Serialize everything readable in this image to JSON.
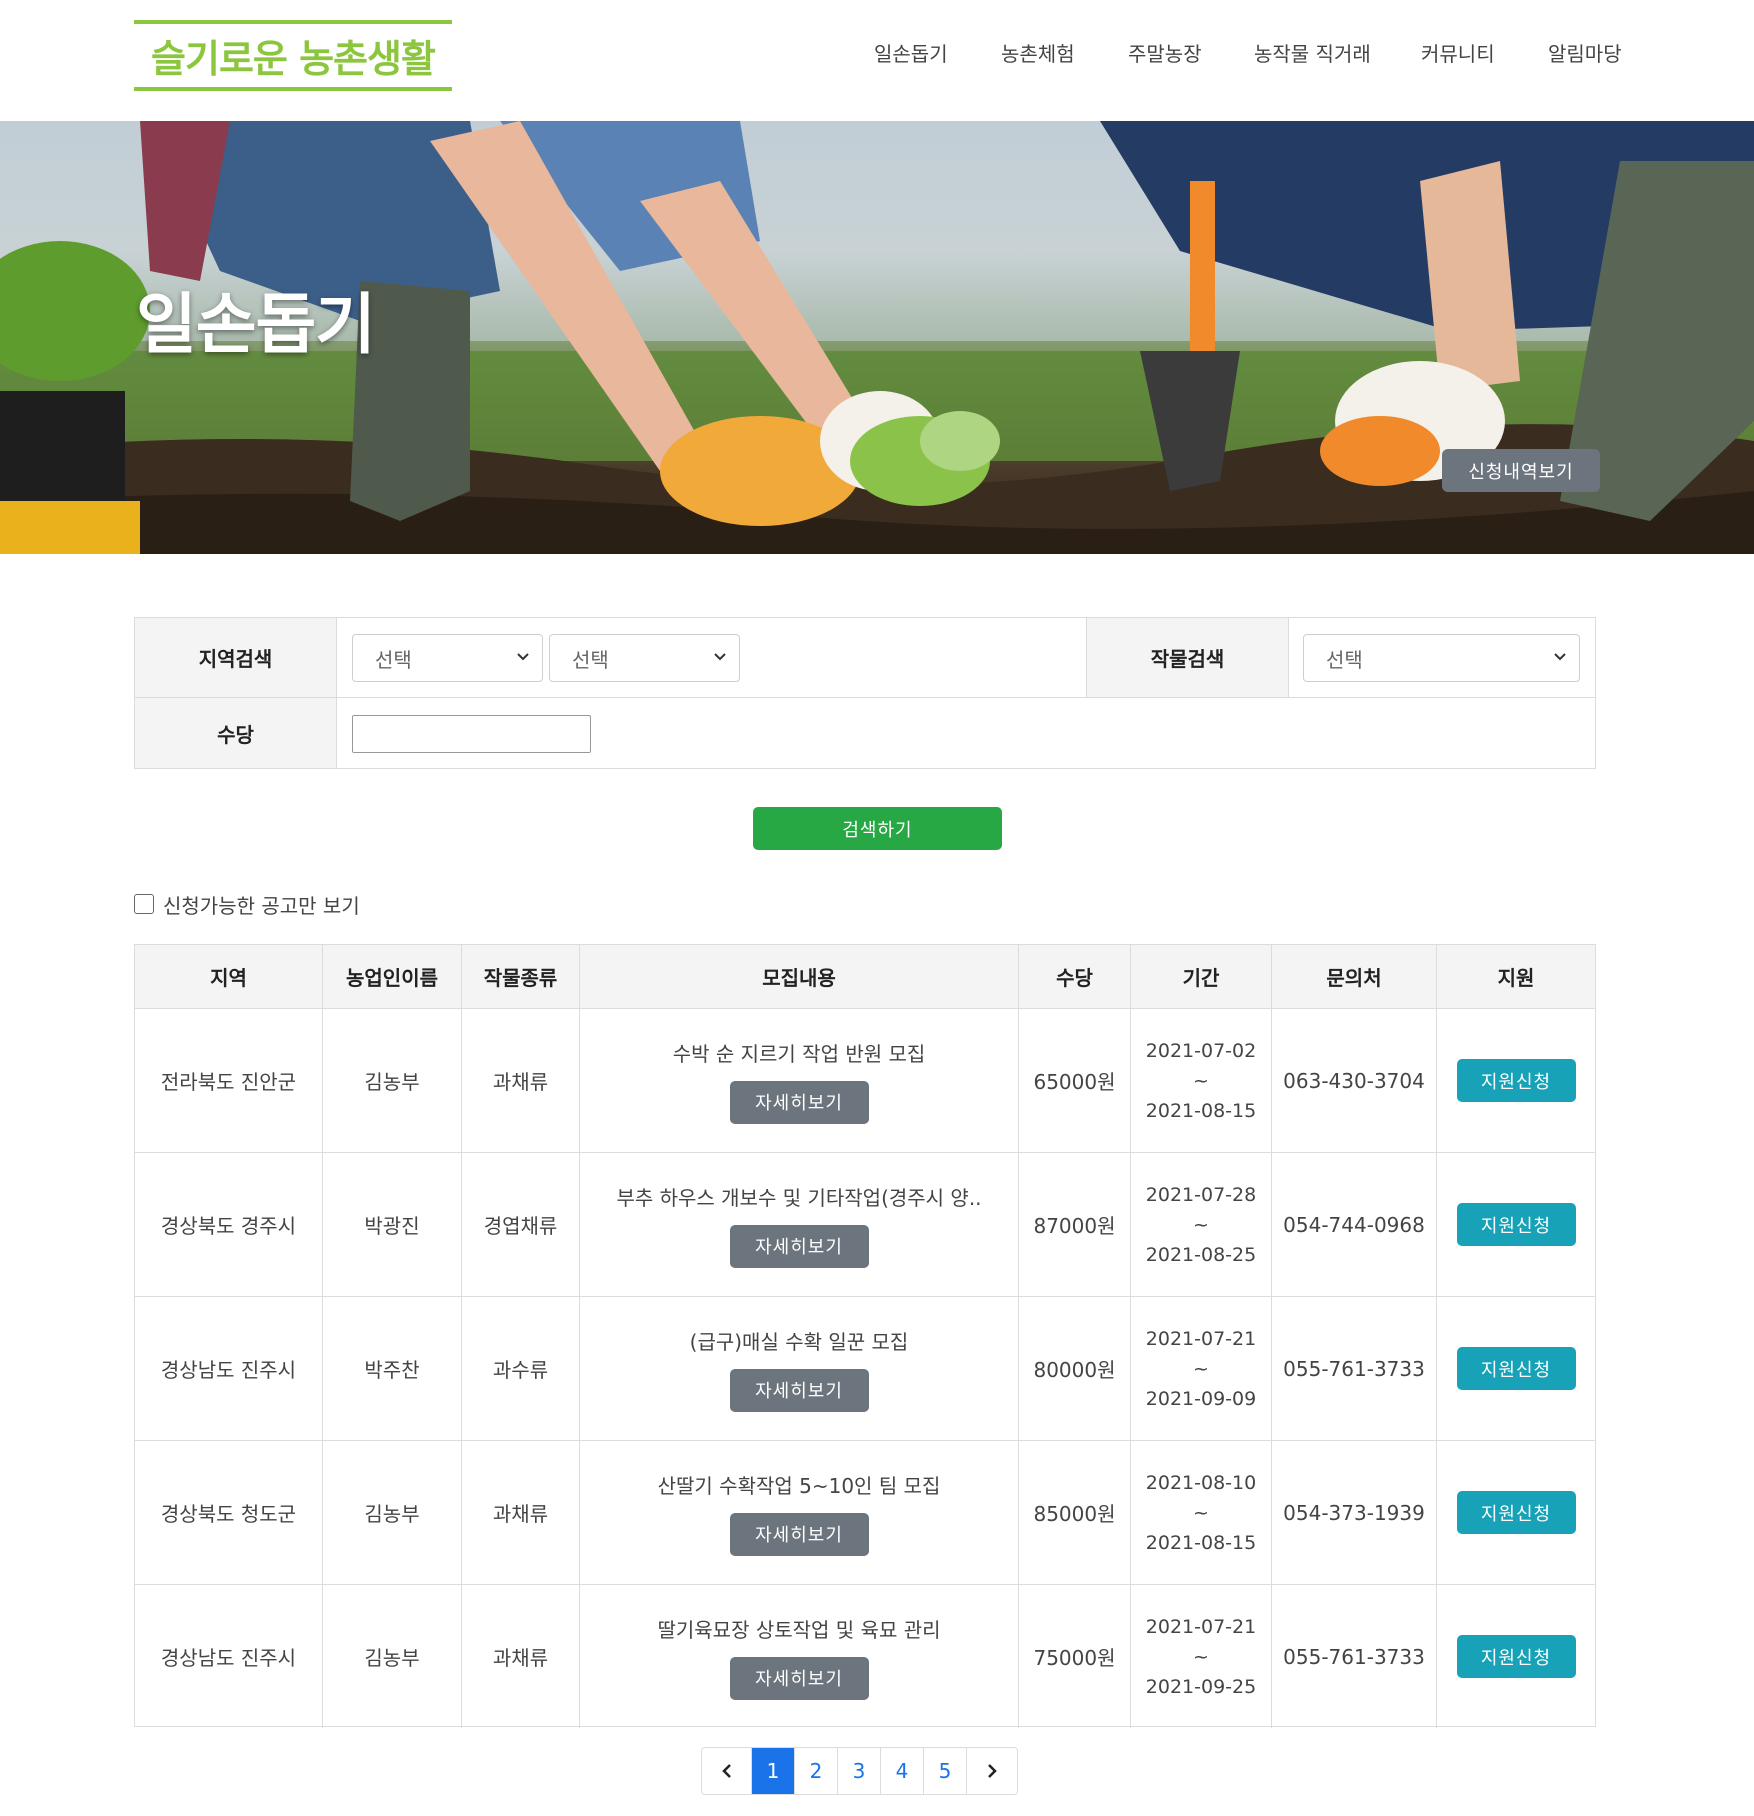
{
  "header": {
    "logo": "슬기로운 농촌생활",
    "nav": [
      "일손돕기",
      "농촌체험",
      "주말농장",
      "농작물 직거래",
      "커뮤니티",
      "알림마당"
    ]
  },
  "hero": {
    "title": "일손돕기",
    "history_button": "신청내역보기"
  },
  "search": {
    "region_label": "지역검색",
    "region_select_1": "선택",
    "region_select_2": "선택",
    "crop_label": "작물검색",
    "crop_select": "선택",
    "wage_label": "수당",
    "wage_value": "",
    "submit": "검색하기",
    "available_only_label": "신청가능한 공고만 보기",
    "available_only_checked": false
  },
  "table": {
    "headers": [
      "지역",
      "농업인이름",
      "작물종류",
      "모집내용",
      "수당",
      "기간",
      "문의처",
      "지원"
    ],
    "detail_label": "자세히보기",
    "apply_label": "지원신청",
    "rows": [
      {
        "region": "전라북도 진안군",
        "farmer": "김농부",
        "crop": "과채류",
        "title": "수박 순 지르기 작업 반원 모집",
        "wage": "65000원",
        "start": "2021-07-02",
        "sep": "~",
        "end": "2021-08-15",
        "contact": "063-430-3704"
      },
      {
        "region": "경상북도 경주시",
        "farmer": "박광진",
        "crop": "경엽채류",
        "title": "부추 하우스 개보수 및 기타작업(경주시 양..",
        "wage": "87000원",
        "start": "2021-07-28",
        "sep": "~",
        "end": "2021-08-25",
        "contact": "054-744-0968"
      },
      {
        "region": "경상남도 진주시",
        "farmer": "박주찬",
        "crop": "과수류",
        "title": "(급구)매실 수확 일꾼 모집",
        "wage": "80000원",
        "start": "2021-07-21",
        "sep": "~",
        "end": "2021-09-09",
        "contact": "055-761-3733"
      },
      {
        "region": "경상북도 청도군",
        "farmer": "김농부",
        "crop": "과채류",
        "title": "산딸기 수확작업 5~10인 팀 모집",
        "wage": "85000원",
        "start": "2021-08-10",
        "sep": "~",
        "end": "2021-08-15",
        "contact": "054-373-1939"
      },
      {
        "region": "경상남도 진주시",
        "farmer": "김농부",
        "crop": "과채류",
        "title": "딸기육묘장 상토작업 및 육묘 관리",
        "wage": "75000원",
        "start": "2021-07-21",
        "sep": "~",
        "end": "2021-09-25",
        "contact": "055-761-3733"
      }
    ]
  },
  "pagination": {
    "pages": [
      "1",
      "2",
      "3",
      "4",
      "5"
    ],
    "current": "1",
    "prev_icon": "chevron-left-icon",
    "next_icon": "chevron-right-icon"
  },
  "colors": {
    "brand_green": "#8cc63f",
    "search_button": "#28a745",
    "apply_button": "#17a2b8",
    "secondary_button": "#6c757d",
    "page_active": "#1a73e8"
  }
}
